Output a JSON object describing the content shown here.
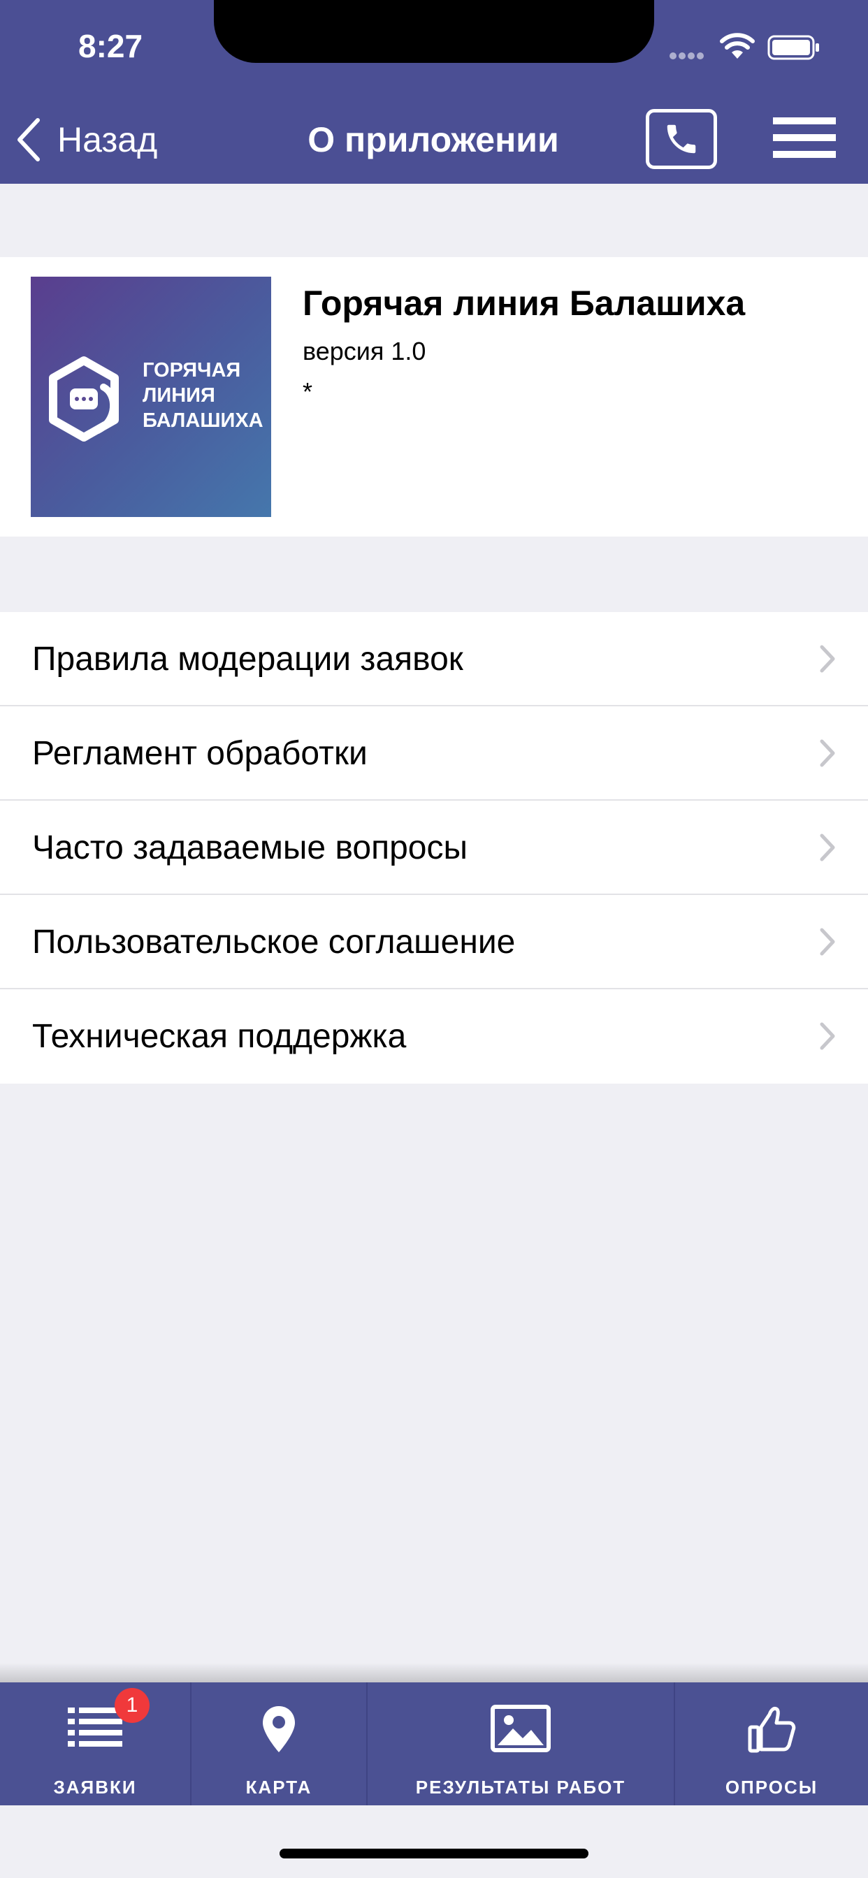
{
  "status_bar": {
    "time": "8:27"
  },
  "nav": {
    "back_label": "Назад",
    "title": "О приложении"
  },
  "app_info": {
    "name": "Горячая линия Балашиха",
    "version": "версия 1.0",
    "note": "*",
    "logo_text": [
      "ГОРЯЧАЯ",
      "ЛИНИЯ",
      "БАЛАШИХА"
    ]
  },
  "menu_items": [
    {
      "label": "Правила модерации заявок"
    },
    {
      "label": "Регламент обработки"
    },
    {
      "label": "Часто задаваемые вопросы"
    },
    {
      "label": "Пользовательское соглашение"
    },
    {
      "label": "Техническая поддержка"
    }
  ],
  "tabs": [
    {
      "label": "ЗАЯВКИ",
      "icon": "list-icon",
      "badge": "1"
    },
    {
      "label": "КАРТА",
      "icon": "map-pin-icon"
    },
    {
      "label": "РЕЗУЛЬТАТЫ РАБОТ",
      "icon": "image-icon"
    },
    {
      "label": "ОПРОСЫ",
      "icon": "thumbs-up-icon"
    }
  ],
  "colors": {
    "header_bg": "#4b4f94",
    "tab_bar_bg": "#4b5193",
    "page_bg": "#efeff4",
    "badge_bg": "#f0393b",
    "chevron": "#c7c7cc"
  }
}
